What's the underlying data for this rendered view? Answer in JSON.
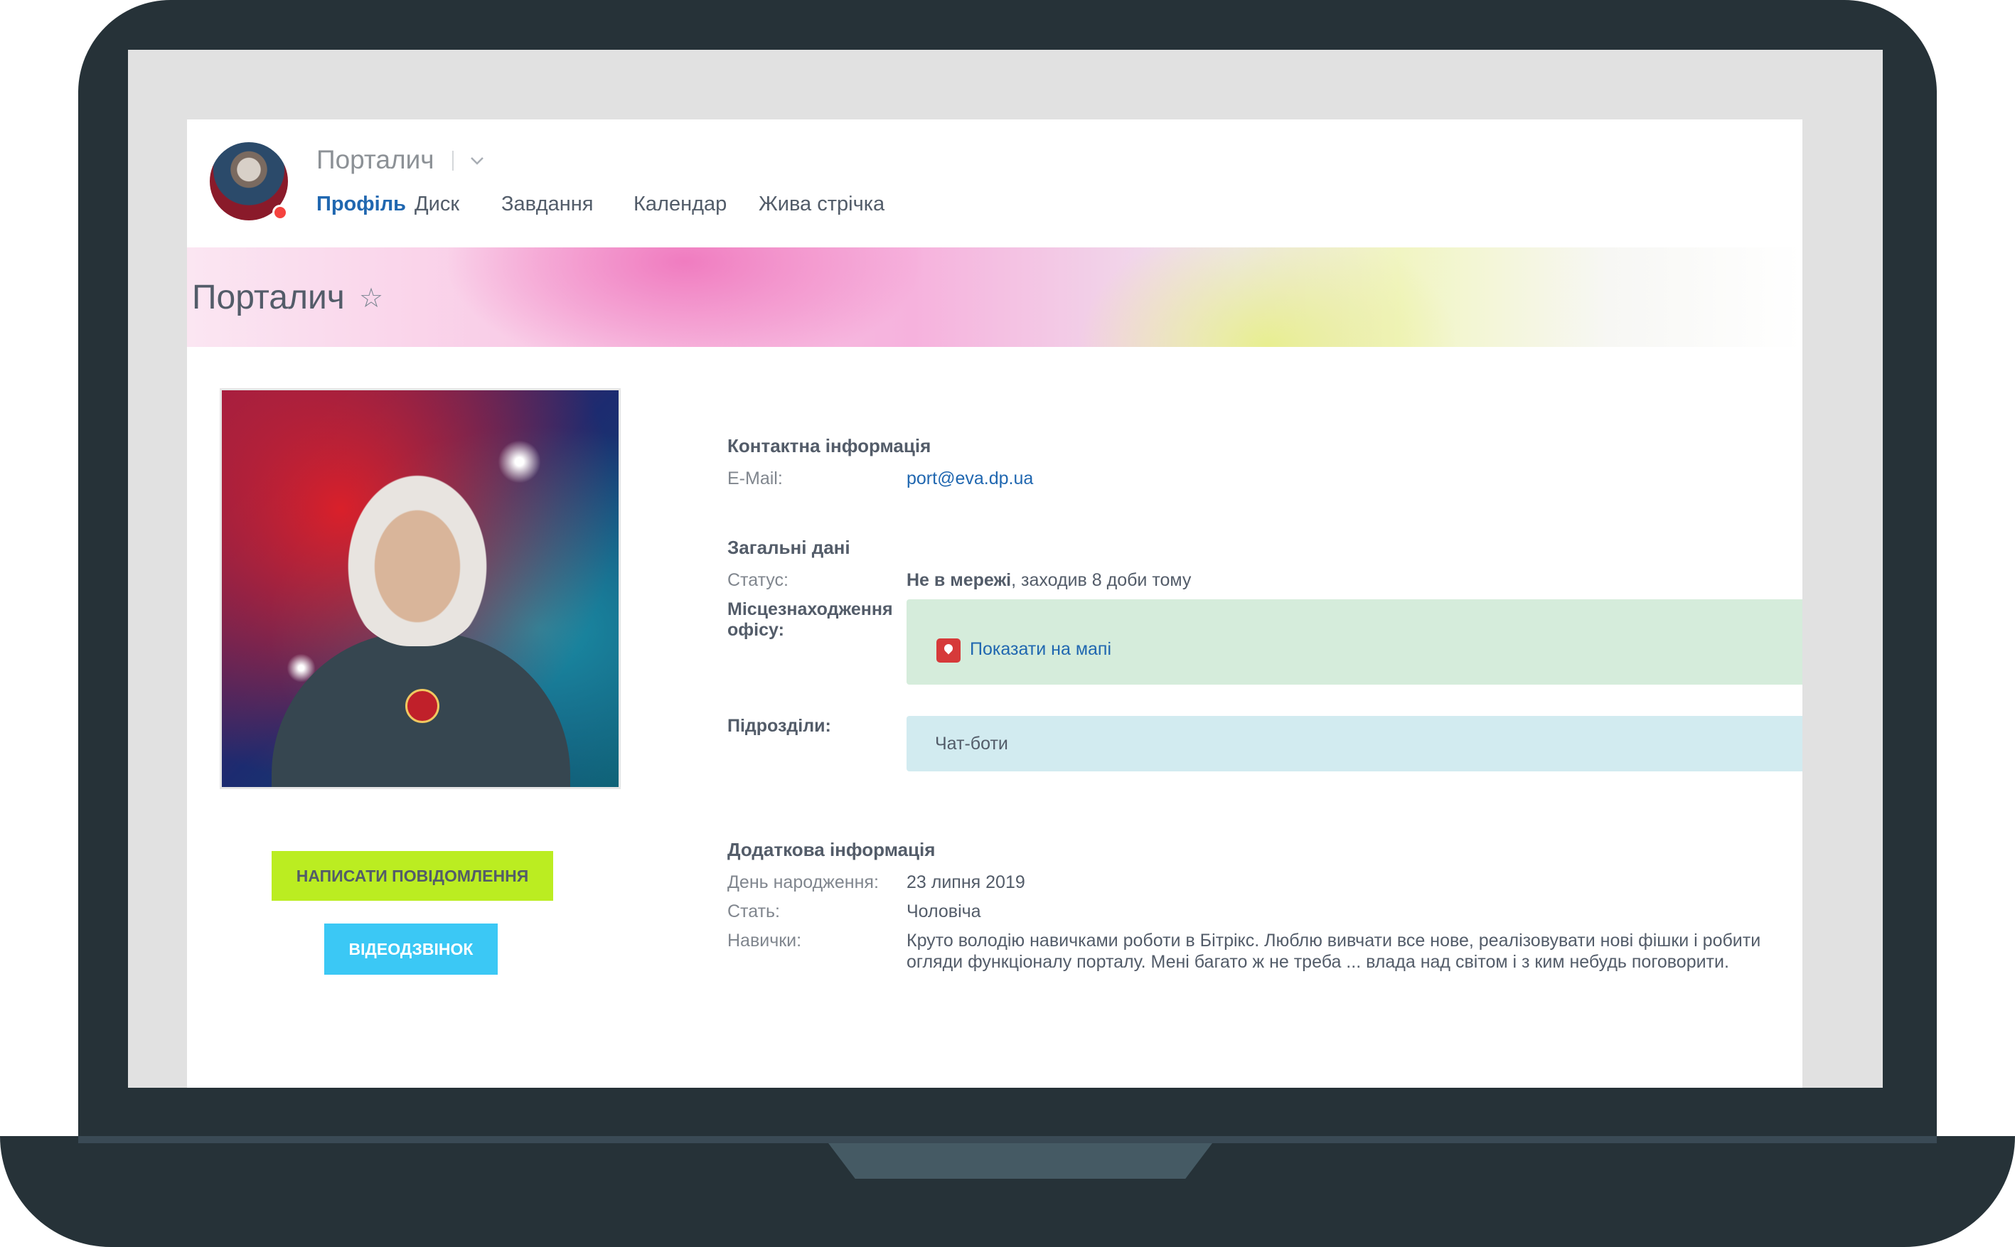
{
  "header": {
    "app_title": "Порталич",
    "tabs": [
      "Профіль",
      "Диск",
      "Завдання",
      "Календар",
      "Жива стрічка"
    ]
  },
  "page": {
    "title": "Порталич",
    "star": "☆"
  },
  "actions": {
    "message_label": "Написати повідомлення",
    "video_label": "Відеодзвінок"
  },
  "contact": {
    "heading": "Контактна інформація",
    "email_label": "E-Mail:",
    "email_value": "port@eva.dp.ua"
  },
  "general": {
    "heading": "Загальні дані",
    "status_label": "Статус:",
    "status_bold": "Не в мережі",
    "status_rest": ", заходив 8 доби тому",
    "office_label_line1": "Місцезнаходження",
    "office_label_line2": "офісу:",
    "map_link": "Показати на мапі",
    "dept_label": "Підрозділи:",
    "dept_value": "Чат-боти"
  },
  "extra": {
    "heading": "Додаткова інформація",
    "birthday_label": "День народження:",
    "birthday_value": "23 липня 2019",
    "gender_label": "Стать:",
    "gender_value": "Чоловіча",
    "skills_label": "Навички:",
    "skills_value": "Круто володію навичками роботи в Бітрікс. Люблю вивчати все нове, реалізовувати нові фішки і робити огляди функціоналу порталу. Мені багато ж не треба ... влада над світом і з ким небудь поговорити."
  },
  "colors": {
    "accent": "#2067b0",
    "message_button": "#bbed21",
    "video_button": "#3bc8f5",
    "office_box": "#d5ecdb",
    "dept_box": "#d2ebf0",
    "frame": "#263238"
  },
  "icons": {
    "favorite": "star-icon",
    "map": "map-pin-icon",
    "title_menu": "chevron-down-icon",
    "online_status": "status-dot-icon"
  }
}
